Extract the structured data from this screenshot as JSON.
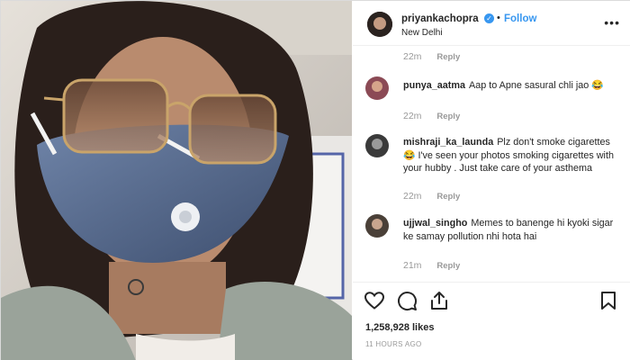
{
  "header": {
    "username": "priyankachopra",
    "follow_label": "Follow",
    "separator": "•",
    "location": "New Delhi",
    "more_icon": "ellipsis-icon"
  },
  "comments": [
    {
      "username": "",
      "text": "",
      "time": "22m",
      "reply": "Reply"
    },
    {
      "username": "punya_aatma",
      "text": "Aap to Apne sasural chli jao 😂",
      "time": "22m",
      "reply": "Reply"
    },
    {
      "username": "mishraji_ka_launda",
      "text": "Plz don't smoke cigarettes 😂 I've seen your photos smoking cigarettes with your hubby . Just take care of your asthema",
      "time": "22m",
      "reply": "Reply"
    },
    {
      "username": "ujjwal_singho",
      "text": "Memes to banenge hi kyoki sigar ke samay pollution nhi hota hai",
      "time": "21m",
      "reply": "Reply"
    }
  ],
  "actions": {
    "icons": [
      "heart-icon",
      "comment-icon",
      "share-icon",
      "bookmark-icon"
    ],
    "likes": "1,258,928 likes",
    "time_ago": "11 HOURS AGO"
  },
  "colors": {
    "link_blue": "#3897f0",
    "muted_gray": "#999999",
    "text_dark": "#262626"
  }
}
